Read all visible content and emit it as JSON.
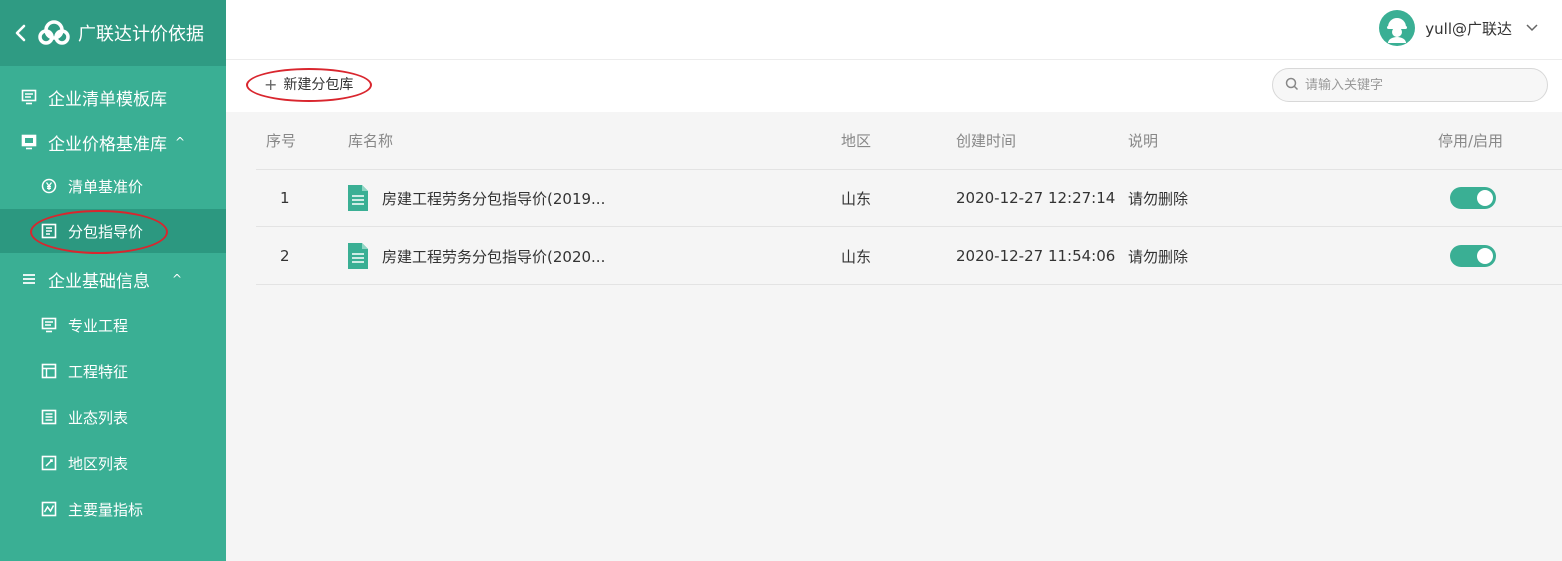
{
  "sidebar": {
    "title": "广联达计价依据",
    "items": [
      {
        "label": "企业清单模板库",
        "icon": "monitor-icon"
      },
      {
        "label": "企业价格基准库",
        "icon": "monitor-icon",
        "caret": "^"
      },
      {
        "label": "清单基准价",
        "icon": "yen-circle-icon"
      },
      {
        "label": "分包指导价",
        "icon": "document-box-icon",
        "active": true
      },
      {
        "label": "企业基础信息",
        "icon": "menu-icon",
        "caret": "^"
      },
      {
        "label": "专业工程",
        "icon": "monitor-icon"
      },
      {
        "label": "工程特征",
        "icon": "layout-icon"
      },
      {
        "label": "业态列表",
        "icon": "list-box-icon"
      },
      {
        "label": "地区列表",
        "icon": "edit-box-icon"
      },
      {
        "label": "主要量指标",
        "icon": "chart-box-icon"
      }
    ]
  },
  "header": {
    "user": "yull@广联达"
  },
  "toolbar": {
    "new_label": "新建分包库",
    "search_placeholder": "请输入关键字"
  },
  "table": {
    "headers": {
      "idx": "序号",
      "name": "库名称",
      "area": "地区",
      "time": "创建时间",
      "desc": "说明",
      "switch": "停用/启用"
    },
    "rows": [
      {
        "idx": "1",
        "name": "房建工程劳务分包指导价(2019...",
        "area": "山东",
        "time": "2020-12-27 12:27:14",
        "desc": "请勿删除",
        "enabled": true
      },
      {
        "idx": "2",
        "name": "房建工程劳务分包指导价(2020...",
        "area": "山东",
        "time": "2020-12-27 11:54:06",
        "desc": "请勿删除",
        "enabled": true
      }
    ]
  },
  "colors": {
    "accent": "#3aaf94",
    "annotation": "#d9262e"
  }
}
